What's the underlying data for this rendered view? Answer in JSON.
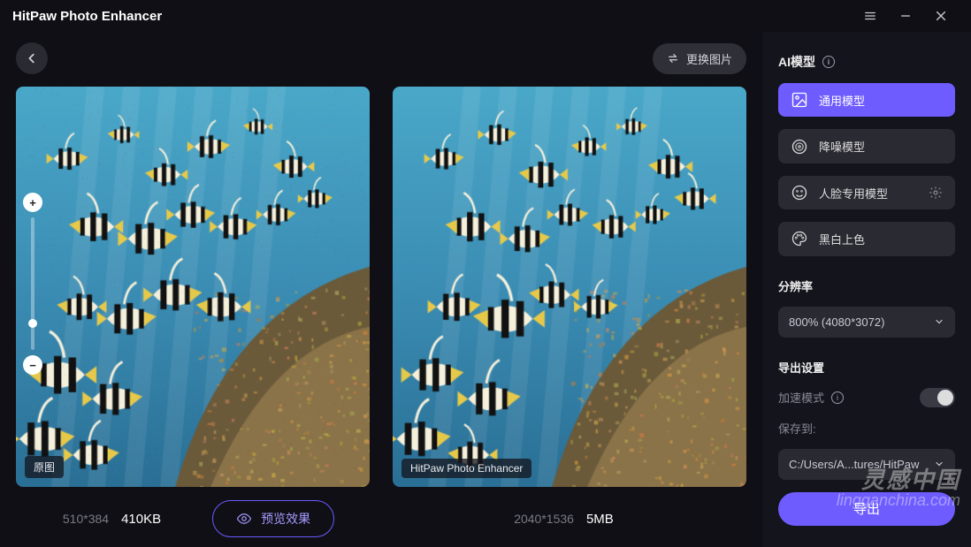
{
  "app": {
    "title": "HitPaw Photo Enhancer"
  },
  "toolbar": {
    "swap_label": "更换图片"
  },
  "panes": {
    "original_label": "原图",
    "enhanced_label": "HitPaw Photo Enhancer"
  },
  "footer": {
    "orig_dims": "510*384",
    "orig_size": "410KB",
    "enh_dims": "2040*1536",
    "enh_size": "5MB",
    "preview_label": "预览效果"
  },
  "sidebar": {
    "ai_title": "AI模型",
    "models": [
      {
        "label": "通用模型",
        "icon": "image"
      },
      {
        "label": "降噪模型",
        "icon": "noise"
      },
      {
        "label": "人脸专用模型",
        "icon": "face",
        "settings": true
      },
      {
        "label": "黑白上色",
        "icon": "palette"
      }
    ],
    "resolution_label": "分辨率",
    "resolution_value": "800% (4080*3072)",
    "export_title": "导出设置",
    "accel_label": "加速模式",
    "save_label": "保存到:",
    "save_value": "C:/Users/A...tures/HitPaw",
    "export_btn": "导出"
  },
  "watermark": {
    "line1": "灵感中国",
    "line2": "lingganchina.com"
  }
}
